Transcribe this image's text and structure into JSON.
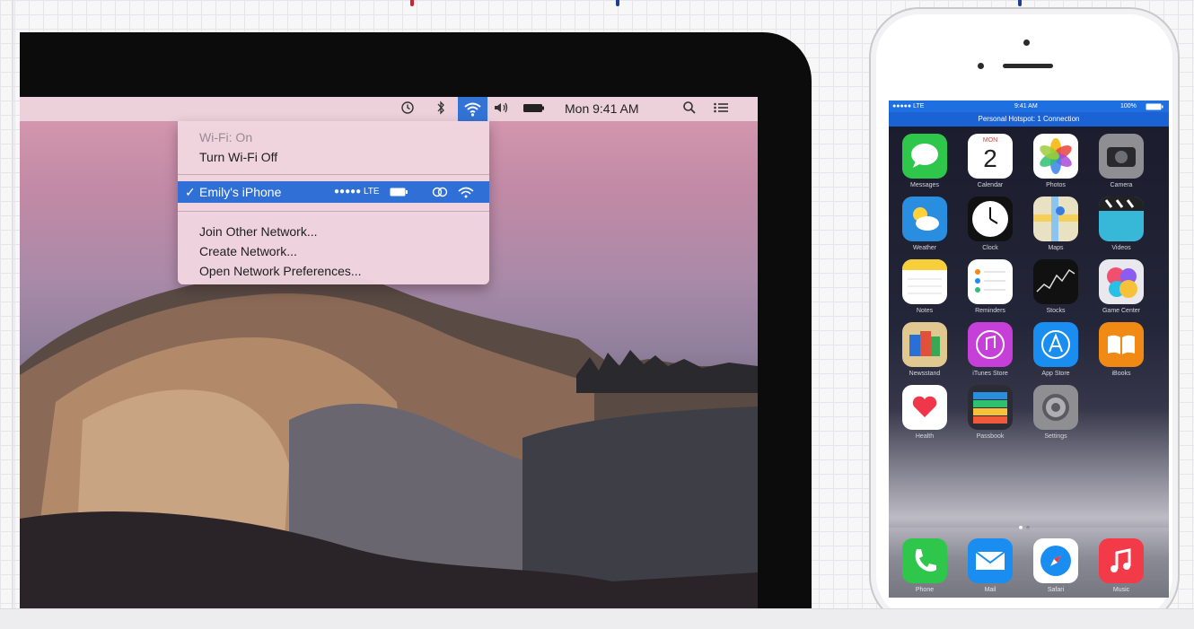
{
  "mac": {
    "menubar": {
      "icons": [
        "time-machine-icon",
        "bluetooth-icon",
        "wifi-icon",
        "volume-icon",
        "battery-icon",
        "spotlight-icon",
        "notification-center-icon"
      ],
      "clock": "Mon 9:41 AM"
    },
    "wifi_menu": {
      "status": "Wi-Fi: On",
      "toggle": "Turn Wi-Fi Off",
      "selected_network": "Emily's iPhone",
      "selected_signal": "●●●●● LTE",
      "join_other": "Join Other Network...",
      "create": "Create Network...",
      "open_prefs": "Open Network Preferences..."
    }
  },
  "iphone": {
    "status_time": "9:41 AM",
    "status_signal": "●●●●● LTE",
    "status_battery": "100%",
    "hotspot_banner": "Personal Hotspot: 1 Connection",
    "apps": [
      {
        "label": "Messages",
        "icon": "messages-icon",
        "color": "#2fc64c"
      },
      {
        "label": "Calendar",
        "icon": "calendar-icon",
        "color": "#ffffff",
        "date": "2"
      },
      {
        "label": "Photos",
        "icon": "photos-icon",
        "color": "#ffffff"
      },
      {
        "label": "Camera",
        "icon": "camera-icon",
        "color": "#8e8e93"
      },
      {
        "label": "Weather",
        "icon": "weather-icon",
        "color": "#2a8ee0"
      },
      {
        "label": "Clock",
        "icon": "clock-icon",
        "color": "#111111"
      },
      {
        "label": "Maps",
        "icon": "maps-icon",
        "color": "#e9e2c2"
      },
      {
        "label": "Videos",
        "icon": "videos-icon",
        "color": "#38b8d8"
      },
      {
        "label": "Notes",
        "icon": "notes-icon",
        "color": "#ffffff"
      },
      {
        "label": "Reminders",
        "icon": "reminders-icon",
        "color": "#ffffff"
      },
      {
        "label": "Stocks",
        "icon": "stocks-icon",
        "color": "#111111"
      },
      {
        "label": "Game Center",
        "icon": "game-center-icon",
        "color": "#e8e8ee"
      },
      {
        "label": "Newsstand",
        "icon": "newsstand-icon",
        "color": "#e0c890"
      },
      {
        "label": "iTunes Store",
        "icon": "itunes-store-icon",
        "color": "#c63fd8"
      },
      {
        "label": "App Store",
        "icon": "app-store-icon",
        "color": "#1a8ef0"
      },
      {
        "label": "iBooks",
        "icon": "ibooks-icon",
        "color": "#f08a14"
      },
      {
        "label": "Health",
        "icon": "health-icon",
        "color": "#ffffff"
      },
      {
        "label": "Passbook",
        "icon": "passbook-icon",
        "color": "#2c2c36"
      },
      {
        "label": "Settings",
        "icon": "settings-icon",
        "color": "#8e8e93"
      }
    ],
    "dock": [
      {
        "label": "Phone",
        "icon": "phone-icon",
        "color": "#2fc64c"
      },
      {
        "label": "Mail",
        "icon": "mail-icon",
        "color": "#1a8ef0"
      },
      {
        "label": "Safari",
        "icon": "safari-icon",
        "color": "#ffffff"
      },
      {
        "label": "Music",
        "icon": "music-icon",
        "color": "#f23a48"
      }
    ]
  },
  "colors": {
    "highlight_blue": "#2f6fd6",
    "menubar_pink": "#eed4de",
    "banner_red": "#d81e2c",
    "banner_blue": "#1c3f9c"
  }
}
